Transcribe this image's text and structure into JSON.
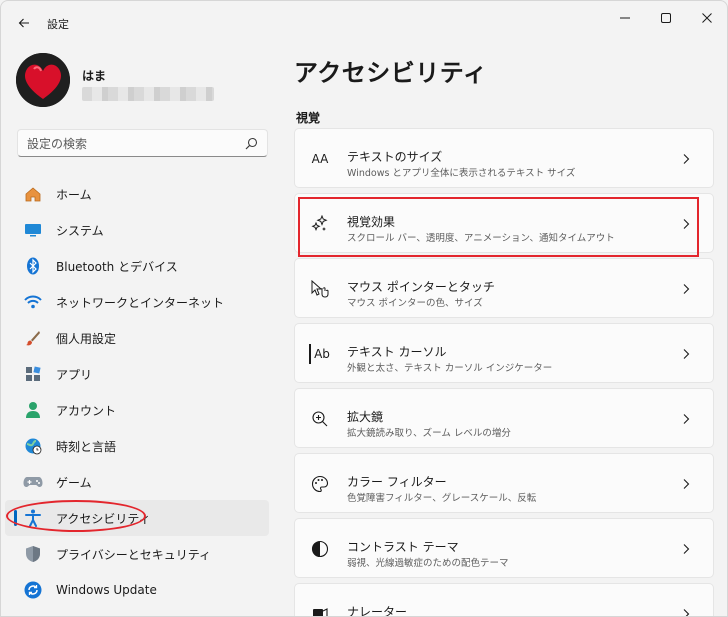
{
  "titlebar": {
    "app_title": "設定"
  },
  "profile": {
    "name": "はま"
  },
  "search": {
    "placeholder": "設定の検索"
  },
  "sidebar": {
    "items": [
      {
        "label": "ホーム",
        "icon": "home-icon"
      },
      {
        "label": "システム",
        "icon": "system-icon"
      },
      {
        "label": "Bluetooth とデバイス",
        "icon": "bluetooth-icon"
      },
      {
        "label": "ネットワークとインターネット",
        "icon": "wifi-icon"
      },
      {
        "label": "個人用設定",
        "icon": "brush-icon"
      },
      {
        "label": "アプリ",
        "icon": "apps-icon"
      },
      {
        "label": "アカウント",
        "icon": "account-icon"
      },
      {
        "label": "時刻と言語",
        "icon": "globe-clock-icon"
      },
      {
        "label": "ゲーム",
        "icon": "gamepad-icon"
      },
      {
        "label": "アクセシビリティ",
        "icon": "accessibility-icon",
        "selected": true
      },
      {
        "label": "プライバシーとセキュリティ",
        "icon": "shield-icon"
      },
      {
        "label": "Windows Update",
        "icon": "update-icon"
      }
    ]
  },
  "main": {
    "title": "アクセシビリティ",
    "section": "視覚",
    "cards": [
      {
        "title": "テキストのサイズ",
        "desc": "Windows とアプリ全体に表示されるテキスト サイズ",
        "icon": "text-size-icon",
        "icon_text": "AA"
      },
      {
        "title": "視覚効果",
        "desc": "スクロール バー、透明度、アニメーション、通知タイムアウト",
        "icon": "sparkle-icon"
      },
      {
        "title": "マウス ポインターとタッチ",
        "desc": "マウス ポインターの色、サイズ",
        "icon": "pointer-touch-icon"
      },
      {
        "title": "テキスト カーソル",
        "desc": "外観と太さ、テキスト カーソル インジケーター",
        "icon": "text-cursor-icon",
        "icon_text": "Ab"
      },
      {
        "title": "拡大鏡",
        "desc": "拡大鏡読み取り、ズーム レベルの増分",
        "icon": "magnifier-icon"
      },
      {
        "title": "カラー フィルター",
        "desc": "色覚障害フィルター、グレースケール、反転",
        "icon": "palette-icon"
      },
      {
        "title": "コントラスト テーマ",
        "desc": "弱視、光線過敏症のための配色テーマ",
        "icon": "contrast-icon"
      },
      {
        "title": "ナレーター",
        "desc": "",
        "icon": "narrator-icon"
      }
    ]
  },
  "colors": {
    "accent": "#0067c0",
    "annotation": "#e3262d"
  }
}
